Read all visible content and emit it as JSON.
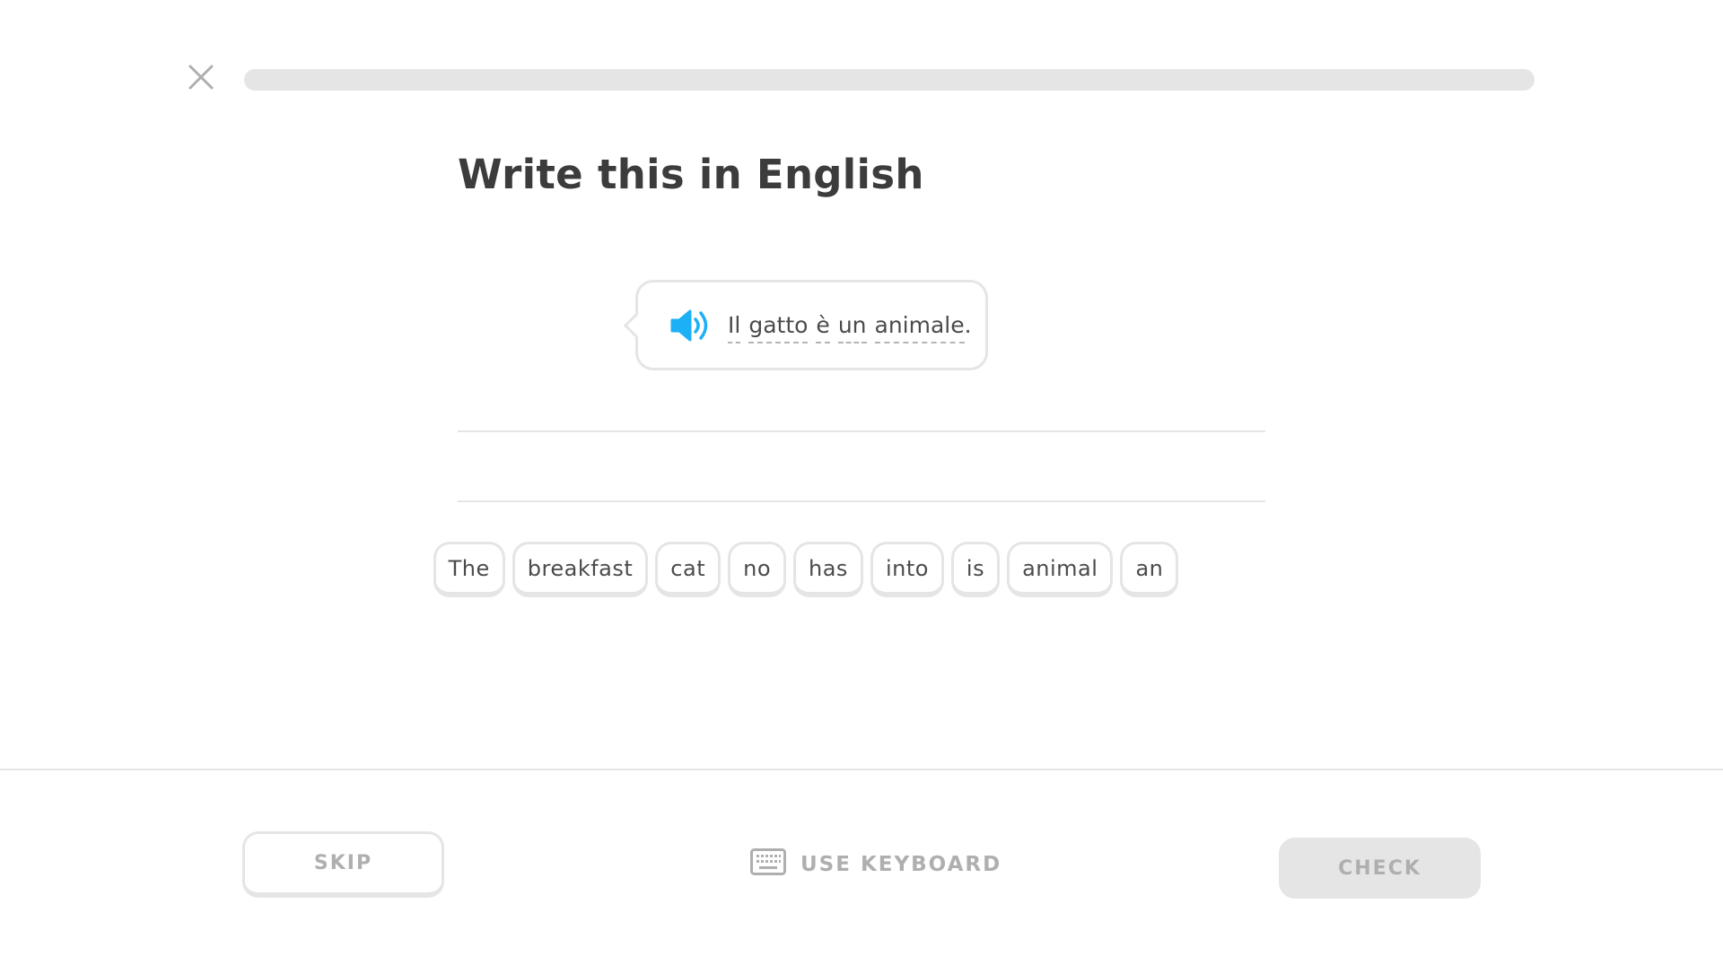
{
  "header": {
    "close_icon": "close-icon",
    "progress": 0
  },
  "exercise": {
    "title": "Write this in English",
    "prompt_words": [
      "Il",
      "gatto",
      "è",
      "un",
      "animale"
    ],
    "prompt_end": ".",
    "speaker_icon": "speaker-icon"
  },
  "word_bank": [
    "The",
    "breakfast",
    "cat",
    "no",
    "has",
    "into",
    "is",
    "animal",
    "an"
  ],
  "footer": {
    "skip_label": "SKIP",
    "keyboard_label": "USE KEYBOARD",
    "keyboard_icon": "keyboard-icon",
    "check_label": "CHECK"
  },
  "colors": {
    "accent_blue": "#1cb0f6",
    "border_gray": "#e5e5e5",
    "disabled_text": "#afafaf",
    "text_dark": "#3c3c3c"
  }
}
